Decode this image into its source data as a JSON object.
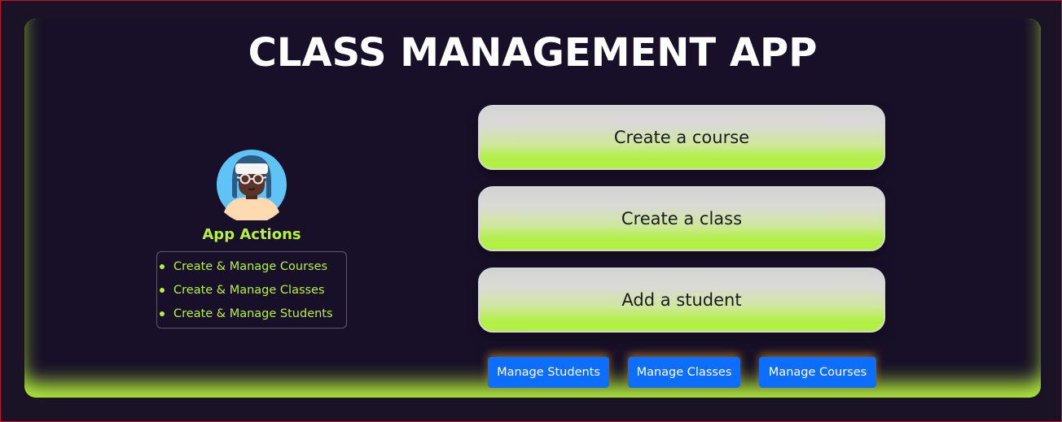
{
  "app": {
    "title": "CLASS MANAGEMENT APP"
  },
  "profile": {
    "avatar_icon": "person-avatar-icon",
    "heading": "App Actions",
    "actions": [
      "Create & Manage Courses",
      "Create & Manage Classes",
      "Create & Manage Students"
    ]
  },
  "primary_actions": [
    {
      "label": "Create a course"
    },
    {
      "label": "Create a class"
    },
    {
      "label": "Add a student"
    }
  ],
  "manage_buttons": [
    {
      "label": "Manage Students"
    },
    {
      "label": "Manage Classes"
    },
    {
      "label": "Manage Courses"
    }
  ],
  "colors": {
    "background": "#1a1326",
    "panel": "#181028",
    "accent_green": "#b6f23c",
    "button_blue": "#0d6efd",
    "title_text": "#ffffff"
  }
}
